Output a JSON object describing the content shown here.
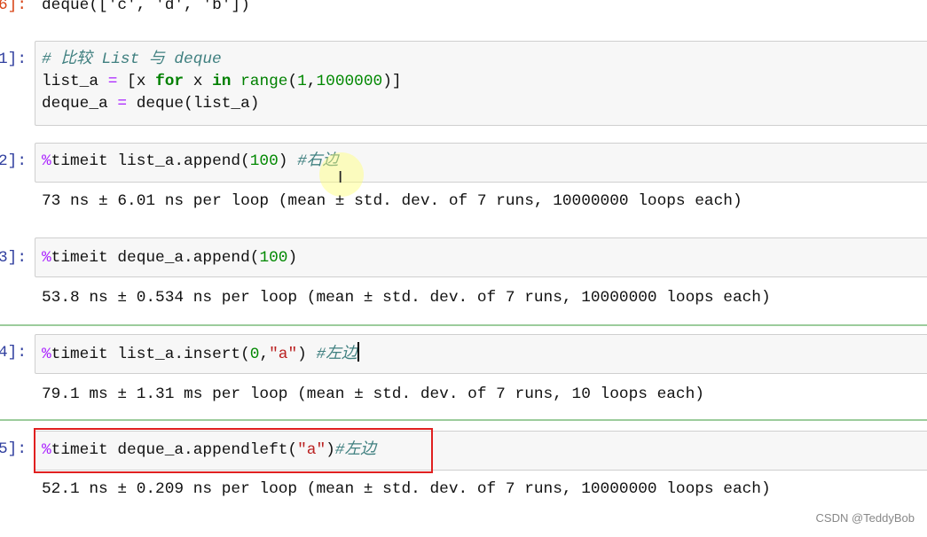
{
  "cells": [
    {
      "prompt": "6]:",
      "kind": "output-only",
      "output": "deque(['c', 'd', 'b'])"
    },
    {
      "prompt": "1]:",
      "lines": [
        [
          {
            "t": "cm",
            "v": "# 比较 List 与 deque"
          }
        ],
        [
          {
            "t": "pl",
            "v": "list_a "
          },
          {
            "t": "op",
            "v": "="
          },
          {
            "t": "pl",
            "v": " [x "
          },
          {
            "t": "kw",
            "v": "for"
          },
          {
            "t": "pl",
            "v": " x "
          },
          {
            "t": "kw",
            "v": "in"
          },
          {
            "t": "pl",
            "v": " "
          },
          {
            "t": "bi",
            "v": "range"
          },
          {
            "t": "pl",
            "v": "("
          },
          {
            "t": "num",
            "v": "1"
          },
          {
            "t": "pl",
            "v": ","
          },
          {
            "t": "num",
            "v": "1000000"
          },
          {
            "t": "pl",
            "v": ")]"
          }
        ],
        [
          {
            "t": "pl",
            "v": "deque_a "
          },
          {
            "t": "op",
            "v": "="
          },
          {
            "t": "pl",
            "v": " deque(list_a)"
          }
        ]
      ]
    },
    {
      "prompt": "2]:",
      "lines": [
        [
          {
            "t": "magic",
            "v": "%"
          },
          {
            "t": "pl",
            "v": "timeit list_a.append("
          },
          {
            "t": "num",
            "v": "100"
          },
          {
            "t": "pl",
            "v": ") "
          },
          {
            "t": "cm",
            "v": "#右边"
          }
        ]
      ],
      "output": "73 ns ± 6.01 ns per loop (mean ± std. dev. of 7 runs, 10000000 loops each)"
    },
    {
      "prompt": "3]:",
      "lines": [
        [
          {
            "t": "magic",
            "v": "%"
          },
          {
            "t": "pl",
            "v": "timeit deque_a.append("
          },
          {
            "t": "num",
            "v": "100"
          },
          {
            "t": "pl",
            "v": ")"
          }
        ]
      ],
      "output": "53.8 ns ± 0.534 ns per loop (mean ± std. dev. of 7 runs, 10000000 loops each)"
    },
    {
      "prompt": "4]:",
      "lines": [
        [
          {
            "t": "magic",
            "v": "%"
          },
          {
            "t": "pl",
            "v": "timeit list_a.insert("
          },
          {
            "t": "num",
            "v": "0"
          },
          {
            "t": "pl",
            "v": ","
          },
          {
            "t": "str",
            "v": "\"a\""
          },
          {
            "t": "pl",
            "v": ") "
          },
          {
            "t": "cm",
            "v": "#左边"
          }
        ]
      ],
      "output": "79.1 ms ± 1.31 ms per loop (mean ± std. dev. of 7 runs, 10 loops each)"
    },
    {
      "prompt": "5]:",
      "lines": [
        [
          {
            "t": "magic",
            "v": "%"
          },
          {
            "t": "pl",
            "v": "timeit deque_a.appendleft("
          },
          {
            "t": "str",
            "v": "\"a\""
          },
          {
            "t": "pl",
            "v": ")"
          },
          {
            "t": "cm",
            "v": "#左边"
          }
        ]
      ],
      "output": "52.1 ns ± 0.209 ns per loop (mean ± std. dev. of 7 runs, 10000000 loops each)"
    }
  ],
  "watermark": "CSDN @TeddyBob",
  "colors": {
    "keyword": "#008000",
    "comment": "#408080",
    "string": "#ba2121",
    "magic": "#aa22ff",
    "highlight_box": "#e02020",
    "selected_cell_border": "#9ccc9c"
  }
}
